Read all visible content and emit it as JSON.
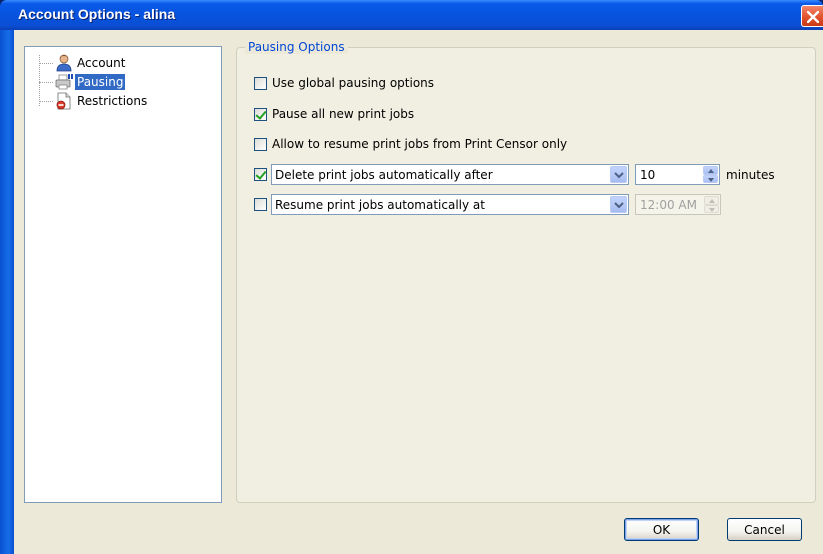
{
  "window": {
    "title": "Account Options - alina"
  },
  "tree": {
    "items": [
      {
        "label": "Account",
        "icon": "user-icon",
        "selected": false
      },
      {
        "label": "Pausing",
        "icon": "printer-pause-icon",
        "selected": true
      },
      {
        "label": "Restrictions",
        "icon": "document-restriction-icon",
        "selected": false
      }
    ]
  },
  "pausing": {
    "group_title": "Pausing Options",
    "use_global": {
      "label": "Use global pausing options",
      "checked": false
    },
    "pause_new": {
      "label": "Pause all new print jobs",
      "checked": true
    },
    "allow_resume": {
      "label": "Allow to resume print jobs from Print Censor only",
      "checked": false
    },
    "delete_auto": {
      "checked": true,
      "selected": "Delete print jobs automatically after",
      "value": "10",
      "units": "minutes"
    },
    "resume_auto": {
      "checked": false,
      "selected": "Resume print jobs automatically at",
      "value": "12:00 AM"
    }
  },
  "buttons": {
    "ok": "OK",
    "cancel": "Cancel"
  }
}
